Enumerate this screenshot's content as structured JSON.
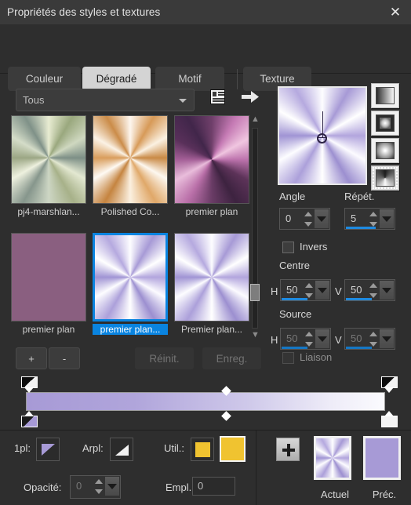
{
  "window": {
    "title": "Propriétés des styles et textures",
    "close_icon": "close-icon"
  },
  "tabs": [
    {
      "label": "Couleur",
      "active": false
    },
    {
      "label": "Dégradé",
      "active": true
    },
    {
      "label": "Motif",
      "active": false
    },
    {
      "label": "Texture",
      "active": false
    }
  ],
  "toolbar": {
    "category_value": "Tous",
    "list_icon": "list-view-icon",
    "arrow_icon": "arrow-right-icon"
  },
  "gradients": [
    {
      "label": "pj4-marshlan...",
      "style": "cone-green",
      "selected": false
    },
    {
      "label": "Polished Co...",
      "style": "cone-orange",
      "selected": false
    },
    {
      "label": "premier plan",
      "style": "cone-purple",
      "selected": false
    },
    {
      "label": "premier plan",
      "style": "flat-plum",
      "selected": false
    },
    {
      "label": "premier plan...",
      "style": "cone-lav",
      "selected": true
    },
    {
      "label": "Premier plan...",
      "style": "cone-lav",
      "selected": false
    }
  ],
  "gradient_types": [
    {
      "name": "linear-gradient-type",
      "selected": false
    },
    {
      "name": "rectangular-gradient-type",
      "selected": false
    },
    {
      "name": "radial-gradient-type",
      "selected": false
    },
    {
      "name": "conical-gradient-type",
      "selected": true
    }
  ],
  "settings": {
    "angle_label": "Angle",
    "angle_value": "0",
    "repeat_label": "Répét.",
    "repeat_value": "5",
    "invert_label": "Invers",
    "invert_checked": false,
    "centre_label": "Centre",
    "centre_h_label": "H",
    "centre_h_value": "50",
    "centre_v_label": "V",
    "centre_v_value": "50",
    "source_label": "Source",
    "source_h_label": "H",
    "source_h_value": "50",
    "source_v_label": "V",
    "source_v_value": "50",
    "link_label": "Liaison",
    "link_checked": false
  },
  "actions": {
    "add_label": "+",
    "remove_label": "-",
    "reset_label": "Réinit.",
    "save_label": "Enreg."
  },
  "bottom": {
    "layer_label": "1pl:",
    "arpl_label": "Arpl:",
    "util_label": "Util.:",
    "opacity_label": "Opacité:",
    "opacity_value": "0",
    "empl_label": "Empl.:",
    "empl_value": "0",
    "current_label": "Actuel",
    "previous_label": "Préc."
  },
  "colors": {
    "accent_blue": "#0a84e0",
    "slider_blue": "#1e8ae0",
    "util_swatch_a": "#f0c330",
    "util_swatch_b": "#f0c330",
    "lavender": "#a79ad6",
    "titlebar": "#3a3a3a",
    "body": "#2e2e2e"
  }
}
